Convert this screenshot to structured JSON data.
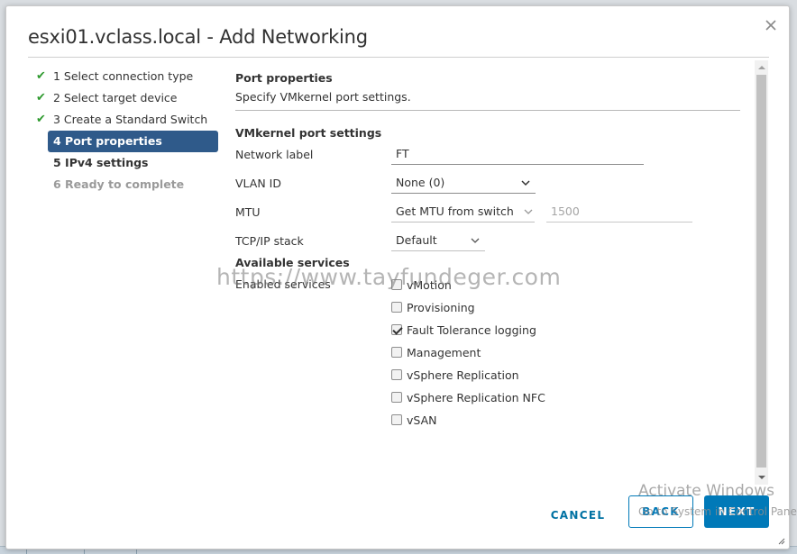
{
  "dialog": {
    "title": "esxi01.vclass.local - Add Networking"
  },
  "steps": [
    {
      "label": "1 Select connection type",
      "state": "done"
    },
    {
      "label": "2 Select target device",
      "state": "done"
    },
    {
      "label": "3 Create a Standard Switch",
      "state": "done"
    },
    {
      "label": "4 Port properties",
      "state": "active"
    },
    {
      "label": "5 IPv4 settings",
      "state": "pending"
    },
    {
      "label": "6 Ready to complete",
      "state": "disabled"
    }
  ],
  "content": {
    "section_title": "Port properties",
    "section_desc": "Specify VMkernel port settings.",
    "vmk_heading": "VMkernel port settings",
    "network_label": {
      "label": "Network label",
      "value": "FT"
    },
    "vlan_id": {
      "label": "VLAN ID",
      "value": "None (0)"
    },
    "mtu": {
      "label": "MTU",
      "mode": "Get MTU from switch",
      "value": "1500"
    },
    "tcpip": {
      "label": "TCP/IP stack",
      "value": "Default"
    },
    "services_heading": "Available services",
    "services_label": "Enabled services",
    "services": [
      {
        "label": "vMotion",
        "checked": false
      },
      {
        "label": "Provisioning",
        "checked": false
      },
      {
        "label": "Fault Tolerance logging",
        "checked": true
      },
      {
        "label": "Management",
        "checked": false
      },
      {
        "label": "vSphere Replication",
        "checked": false
      },
      {
        "label": "vSphere Replication NFC",
        "checked": false
      },
      {
        "label": "vSAN",
        "checked": false
      }
    ]
  },
  "footer": {
    "cancel": "CANCEL",
    "back": "BACK",
    "next": "NEXT"
  },
  "overlay": {
    "watermark": "https://www.tayfundeger.com",
    "activate_title": "Activate Windows",
    "activate_sub": "Go to System in Control Panel to activate Windows."
  },
  "colors": {
    "accent": "#0079b8",
    "active_step": "#2f5a8a",
    "check": "#2f9a2f"
  }
}
